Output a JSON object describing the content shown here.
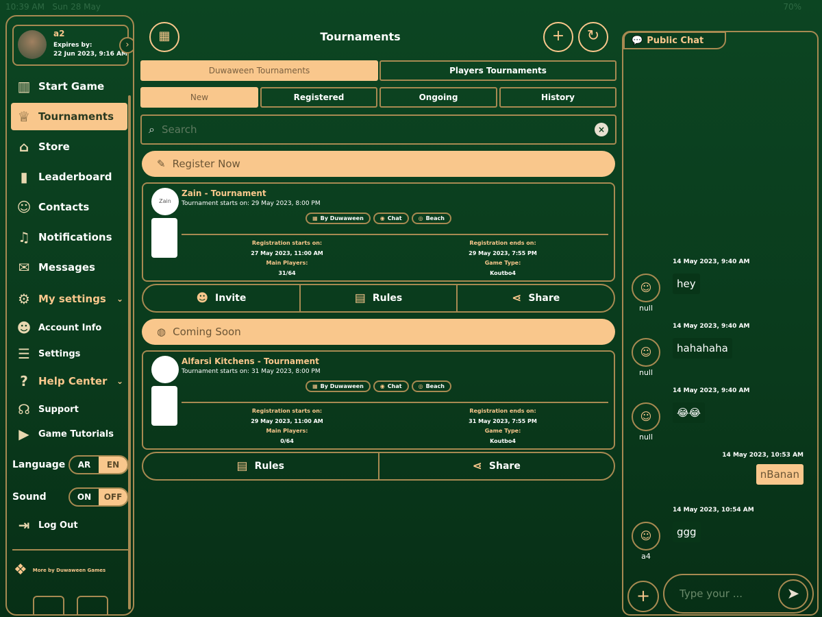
{
  "status": {
    "time": "10:39 AM",
    "date": "Sun 28 May",
    "battery": "70%"
  },
  "profile": {
    "name": "a2",
    "expires_label": "Expires by:",
    "expires": "22 Jun 2023, 9:16 AM"
  },
  "sidebar": {
    "items": [
      {
        "label": "Start Game",
        "icon": "cards-icon"
      },
      {
        "label": "Tournaments",
        "icon": "trophy-icon",
        "active": true
      },
      {
        "label": "Store",
        "icon": "store-icon"
      },
      {
        "label": "Leaderboard",
        "icon": "leaderboard-icon"
      },
      {
        "label": "Contacts",
        "icon": "contacts-icon"
      },
      {
        "label": "Notifications",
        "icon": "bell-icon"
      },
      {
        "label": "Messages",
        "icon": "mail-icon"
      },
      {
        "label": "My settings",
        "icon": "gear-icon"
      },
      {
        "label": "Account Info",
        "icon": "account-icon"
      },
      {
        "label": "Settings",
        "icon": "sliders-icon"
      },
      {
        "label": "Help Center",
        "icon": "help-icon"
      },
      {
        "label": "Support",
        "icon": "support-icon"
      },
      {
        "label": "Game Tutorials",
        "icon": "play-icon"
      }
    ],
    "language": {
      "label": "Language",
      "options": [
        "AR",
        "EN"
      ],
      "selected": "EN"
    },
    "sound": {
      "label": "Sound",
      "options": [
        "ON",
        "OFF"
      ],
      "selected": "OFF"
    },
    "logout": "Log Out",
    "more": "More by Duwaween Games"
  },
  "header": {
    "title": "Tournaments"
  },
  "tabs": {
    "primary": [
      "Duwaween Tournaments",
      "Players Tournaments"
    ],
    "primary_selected": "Duwaween Tournaments",
    "secondary": [
      "New",
      "Registered",
      "Ongoing",
      "History"
    ],
    "secondary_selected": "New"
  },
  "search": {
    "placeholder": "Search",
    "value": ""
  },
  "sections": [
    {
      "banner": "Register Now",
      "card": {
        "title": "Zain - Tournament",
        "logo": "Zain",
        "starts": "Tournament starts on: 29 May 2023, 8:00 PM",
        "chips": [
          "By Duwaween",
          "Chat",
          "Beach"
        ],
        "reg_start_label": "Registration starts on:",
        "reg_start": "27 May 2023, 11:00 AM",
        "players_label": "Main Players:",
        "players": "31/64",
        "reg_end_label": "Registration ends on:",
        "reg_end": "29 May 2023, 7:55 PM",
        "type_label": "Game Type:",
        "type": "Koutbo4"
      },
      "actions": [
        "Invite",
        "Rules",
        "Share"
      ]
    },
    {
      "banner": "Coming Soon",
      "card": {
        "title": "Alfarsi Kitchens - Tournament",
        "starts": "Tournament starts on: 31 May 2023, 8:00 PM",
        "chips": [
          "By Duwaween",
          "Chat",
          "Beach"
        ],
        "reg_start_label": "Registration starts on:",
        "reg_start": "29 May 2023, 11:00 AM",
        "players_label": "Main Players:",
        "players": "0/64",
        "reg_end_label": "Registration ends on:",
        "reg_end": "31 May 2023, 7:55 PM",
        "type_label": "Game Type:",
        "type": "Koutbo4"
      },
      "actions": [
        "Rules",
        "Share"
      ]
    }
  ],
  "chat": {
    "title": "Public Chat",
    "messages": [
      {
        "time": "14 May 2023, 9:40 AM",
        "user": "null",
        "text": "hey",
        "me": false
      },
      {
        "time": "14 May 2023, 9:40 AM",
        "user": "null",
        "text": "hahahaha",
        "me": false
      },
      {
        "time": "14 May 2023, 9:40 AM",
        "user": "null",
        "text": "😂😂",
        "me": false
      },
      {
        "time": "14 May 2023, 10:53 AM",
        "text": "nBanan",
        "me": true
      },
      {
        "time": "14 May 2023, 10:54 AM",
        "user": "a4",
        "text": "ggg",
        "me": false
      }
    ],
    "input_placeholder": "Type your ..."
  },
  "colors": {
    "accent": "#f9c78c",
    "border": "#a88a52",
    "background": "#0b3d1e"
  }
}
